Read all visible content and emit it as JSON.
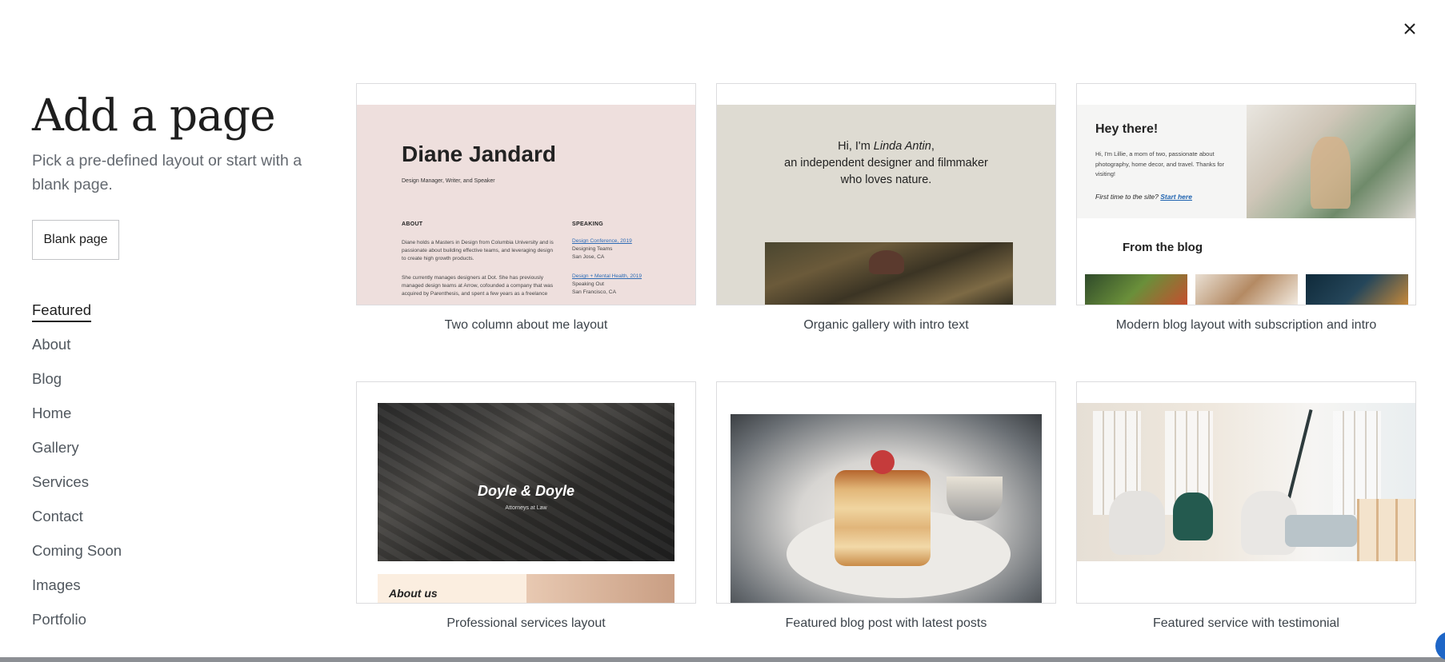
{
  "header": {
    "close_label": "×"
  },
  "sidebar": {
    "title": "Add a page",
    "subtitle": "Pick a pre-defined layout or start with a blank page.",
    "blank_button": "Blank page",
    "categories": [
      {
        "label": "Featured",
        "active": true
      },
      {
        "label": "About",
        "active": false
      },
      {
        "label": "Blog",
        "active": false
      },
      {
        "label": "Home",
        "active": false
      },
      {
        "label": "Gallery",
        "active": false
      },
      {
        "label": "Services",
        "active": false
      },
      {
        "label": "Contact",
        "active": false
      },
      {
        "label": "Coming Soon",
        "active": false
      },
      {
        "label": "Images",
        "active": false
      },
      {
        "label": "Portfolio",
        "active": false
      }
    ]
  },
  "layouts": [
    {
      "label": "Two column about me layout",
      "preview": {
        "name": "Diane Jandard",
        "role": "Design Manager, Writer, and Speaker",
        "about_heading": "ABOUT",
        "about_p1": "Diane holds a Masters in Design from Columbia University and is passionate about building effective teams, and leveraging design to create high growth products.",
        "about_p2": "She currently manages designers at Dot. She has previously managed design teams at Arrow, cofounded a company that was acquired by Parenthesis, and spent a few years as a freelance",
        "speaking_heading": "SPEAKING",
        "talk1_link": "Design Conference, 2019",
        "talk1_title": "Designing Teams",
        "talk1_place": "San Jose, CA",
        "talk2_link": "Design + Mental Health, 2019",
        "talk2_title": "Speaking Out",
        "talk2_place": "San Francisco, CA"
      }
    },
    {
      "label": "Organic gallery with intro text",
      "preview": {
        "line1_prefix": "Hi, I'm ",
        "line1_name": "Linda Antin",
        "line1_suffix": ",",
        "line2": "an independent designer and filmmaker",
        "line3": "who loves nature."
      }
    },
    {
      "label": "Modern blog layout with subscription and intro",
      "preview": {
        "greeting": "Hey there!",
        "bio": "Hi, I'm Lillie, a mom of two, passionate about photography, home decor, and travel. Thanks for visiting!",
        "first_time": "First time to the site? ",
        "start_link": "Start here",
        "blog_heading": "From the blog"
      }
    },
    {
      "label": "Professional services layout",
      "preview": {
        "firm": "Doyle & Doyle",
        "tagline": "Attorneys at Law",
        "about": "About us"
      }
    },
    {
      "label": "Featured blog post with latest posts",
      "preview": {}
    },
    {
      "label": "Featured service with testimonial",
      "preview": {}
    }
  ],
  "colors": {
    "text": "#1e1e1e",
    "muted": "#646970",
    "border": "#dcdcde",
    "accent": "#1e66c7"
  }
}
